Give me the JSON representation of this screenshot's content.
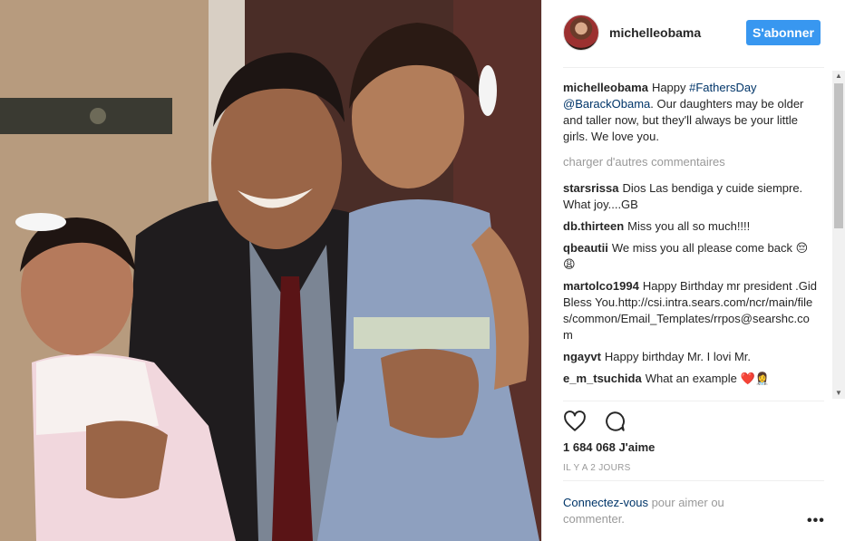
{
  "author": {
    "username": "michelleobama"
  },
  "follow_label": "S'abonner",
  "caption": {
    "username": "michelleobama",
    "prefix": "Happy ",
    "hashtag": "#FathersDay",
    "mention": "@BarackObama",
    "text": ". Our daughters may be older and taller now, but they'll always be your little girls. We love you."
  },
  "load_more": "charger d'autres commentaires",
  "comments": [
    {
      "user": "starsrissa",
      "text": "Dios Las bendiga y cuide siempre. What joy....GB"
    },
    {
      "user": "db.thirteen",
      "text": "Miss you all so much!!!!"
    },
    {
      "user": "qbeautii",
      "text": "We miss you all please come back 😔😩"
    },
    {
      "user": "martolco1994",
      "text": "Happy Birthday mr president .Gid Bless You.http://csi.intra.sears.com/ncr/main/files/common/Email_Templates/rrpos@searshc.com"
    },
    {
      "user": "ngayvt",
      "text": "Happy birthday Mr. I lovi Mr."
    },
    {
      "user": "e_m_tsuchida",
      "text": "What an example ❤️👩‍⚕️"
    }
  ],
  "likes": "1 684 068 J'aime",
  "timestamp": "IL Y A 2 JOURS",
  "login": {
    "link": "Connectez-vous",
    "rest": " pour aimer ou commenter."
  },
  "more_options": "•••",
  "icons": {
    "like": "heart-icon",
    "comment": "comment-bubble-icon",
    "more": "more-options-icon"
  }
}
